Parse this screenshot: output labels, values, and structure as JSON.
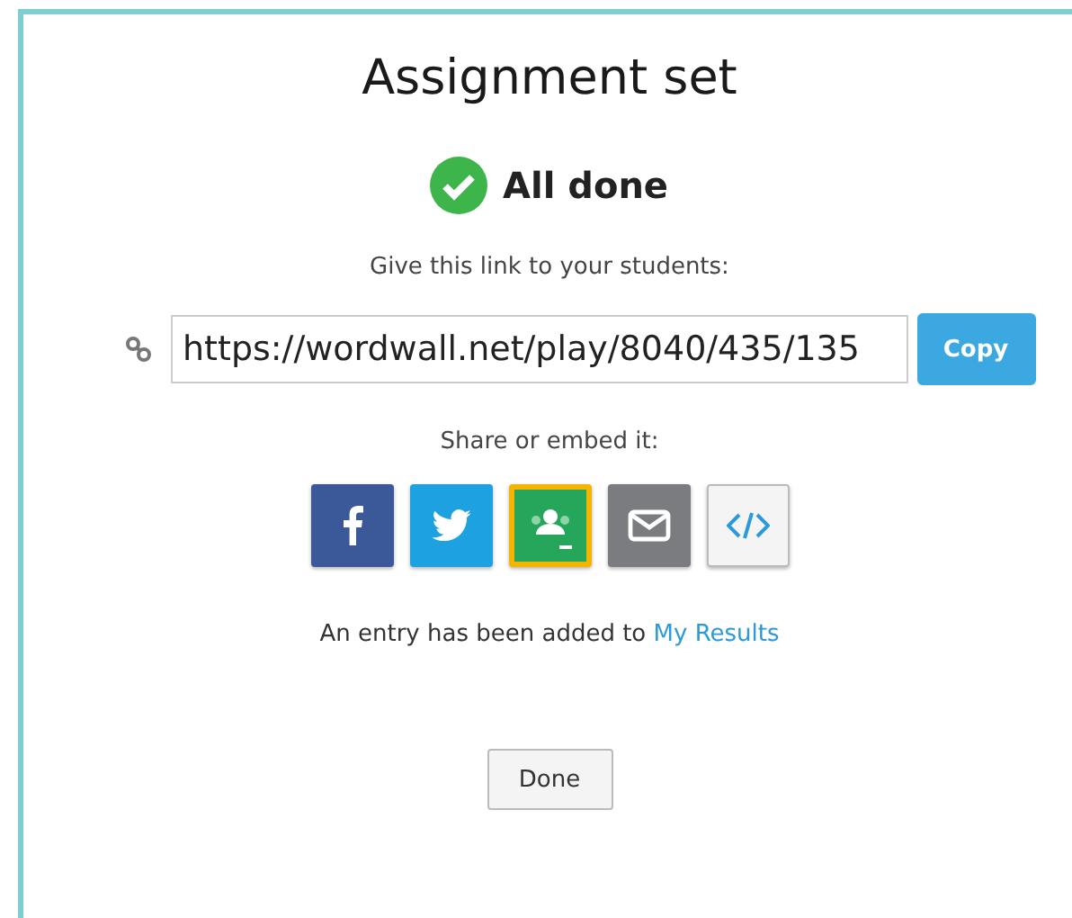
{
  "dialog": {
    "title": "Assignment set",
    "status": "All done",
    "link_prompt": "Give this link to your students:",
    "link_value": "https://wordwall.net/play/8040/435/135",
    "copy_button": "Copy",
    "share_prompt": "Share or embed it:",
    "share_buttons": [
      {
        "kind": "facebook"
      },
      {
        "kind": "twitter"
      },
      {
        "kind": "classroom"
      },
      {
        "kind": "email"
      },
      {
        "kind": "embed"
      }
    ],
    "result_sentence": "An entry has been added to",
    "result_link": "My Results",
    "done_button": "Done"
  }
}
